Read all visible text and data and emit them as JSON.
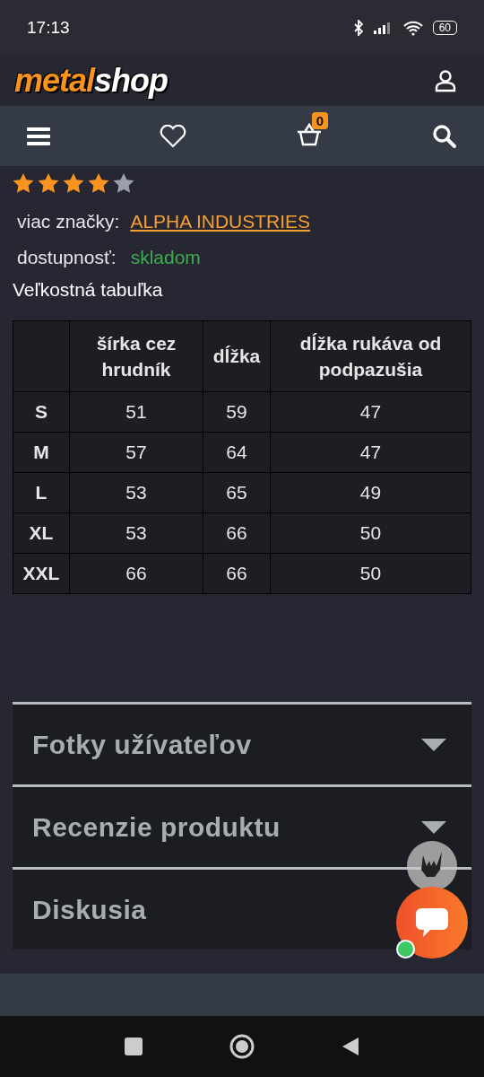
{
  "status_bar": {
    "time": "17:13",
    "battery": "60"
  },
  "header": {
    "logo": [
      "metal",
      "shop"
    ],
    "cart_count": "0"
  },
  "rating": {
    "stars": 4
  },
  "details": [
    {
      "label": "viac značky:",
      "value": "ALPHA INDUSTRIES",
      "kind": "link"
    },
    {
      "label": "dostupnosť:",
      "value": "skladom",
      "kind": "status"
    }
  ],
  "size_table": {
    "title": "Veľkostná tabuľka",
    "columns": [
      "",
      "šírka cez hrudník",
      "dĺžka",
      "dĺžka rukáva od podpazušia"
    ],
    "rows": [
      [
        "S",
        "51",
        "59",
        "47"
      ],
      [
        "M",
        "57",
        "64",
        "47"
      ],
      [
        "L",
        "53",
        "65",
        "49"
      ],
      [
        "XL",
        "53",
        "66",
        "50"
      ],
      [
        "XXL",
        "66",
        "66",
        "50"
      ]
    ]
  },
  "sections": [
    "Fotky užívateľov",
    "Recenzie produktu",
    "Diskusia"
  ]
}
